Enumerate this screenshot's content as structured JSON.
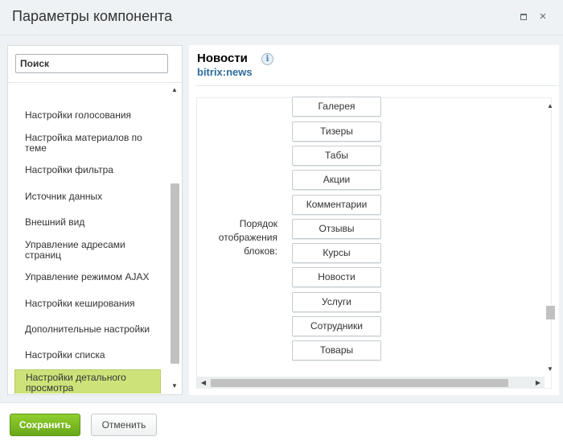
{
  "window": {
    "title": "Параметры компонента",
    "maximize_icon": "maximize-icon",
    "close_icon": "close-icon",
    "close_glyph": "×"
  },
  "sidebar": {
    "search_placeholder": "Поиск",
    "items": [
      {
        "label": "Настройки голосования"
      },
      {
        "label": "Настройка материалов по теме"
      },
      {
        "label": "Настройки фильтра"
      },
      {
        "label": "Источник данных"
      },
      {
        "label": "Внешний вид"
      },
      {
        "label": "Управление адресами страниц"
      },
      {
        "label": "Управление режимом AJAX"
      },
      {
        "label": "Настройки кеширования"
      },
      {
        "label": "Дополнительные настройки"
      },
      {
        "label": "Настройки списка"
      },
      {
        "label": "Настройки детального просмотра",
        "active": true
      }
    ]
  },
  "component": {
    "name": "Новости",
    "code": "bitrix:news",
    "info_glyph": "i"
  },
  "field": {
    "label": "Порядок отображения блоков:",
    "blocks": [
      "Галерея",
      "Тизеры",
      "Табы",
      "Акции",
      "Комментарии",
      "Отзывы",
      "Курсы",
      "Новости",
      "Услуги",
      "Сотрудники",
      "Товары"
    ]
  },
  "footer": {
    "save_label": "Сохранить",
    "cancel_label": "Отменить"
  },
  "colors": {
    "save_button": "#6aa71a",
    "active_item": "#cde37a",
    "code_link": "#2d6d9c"
  }
}
